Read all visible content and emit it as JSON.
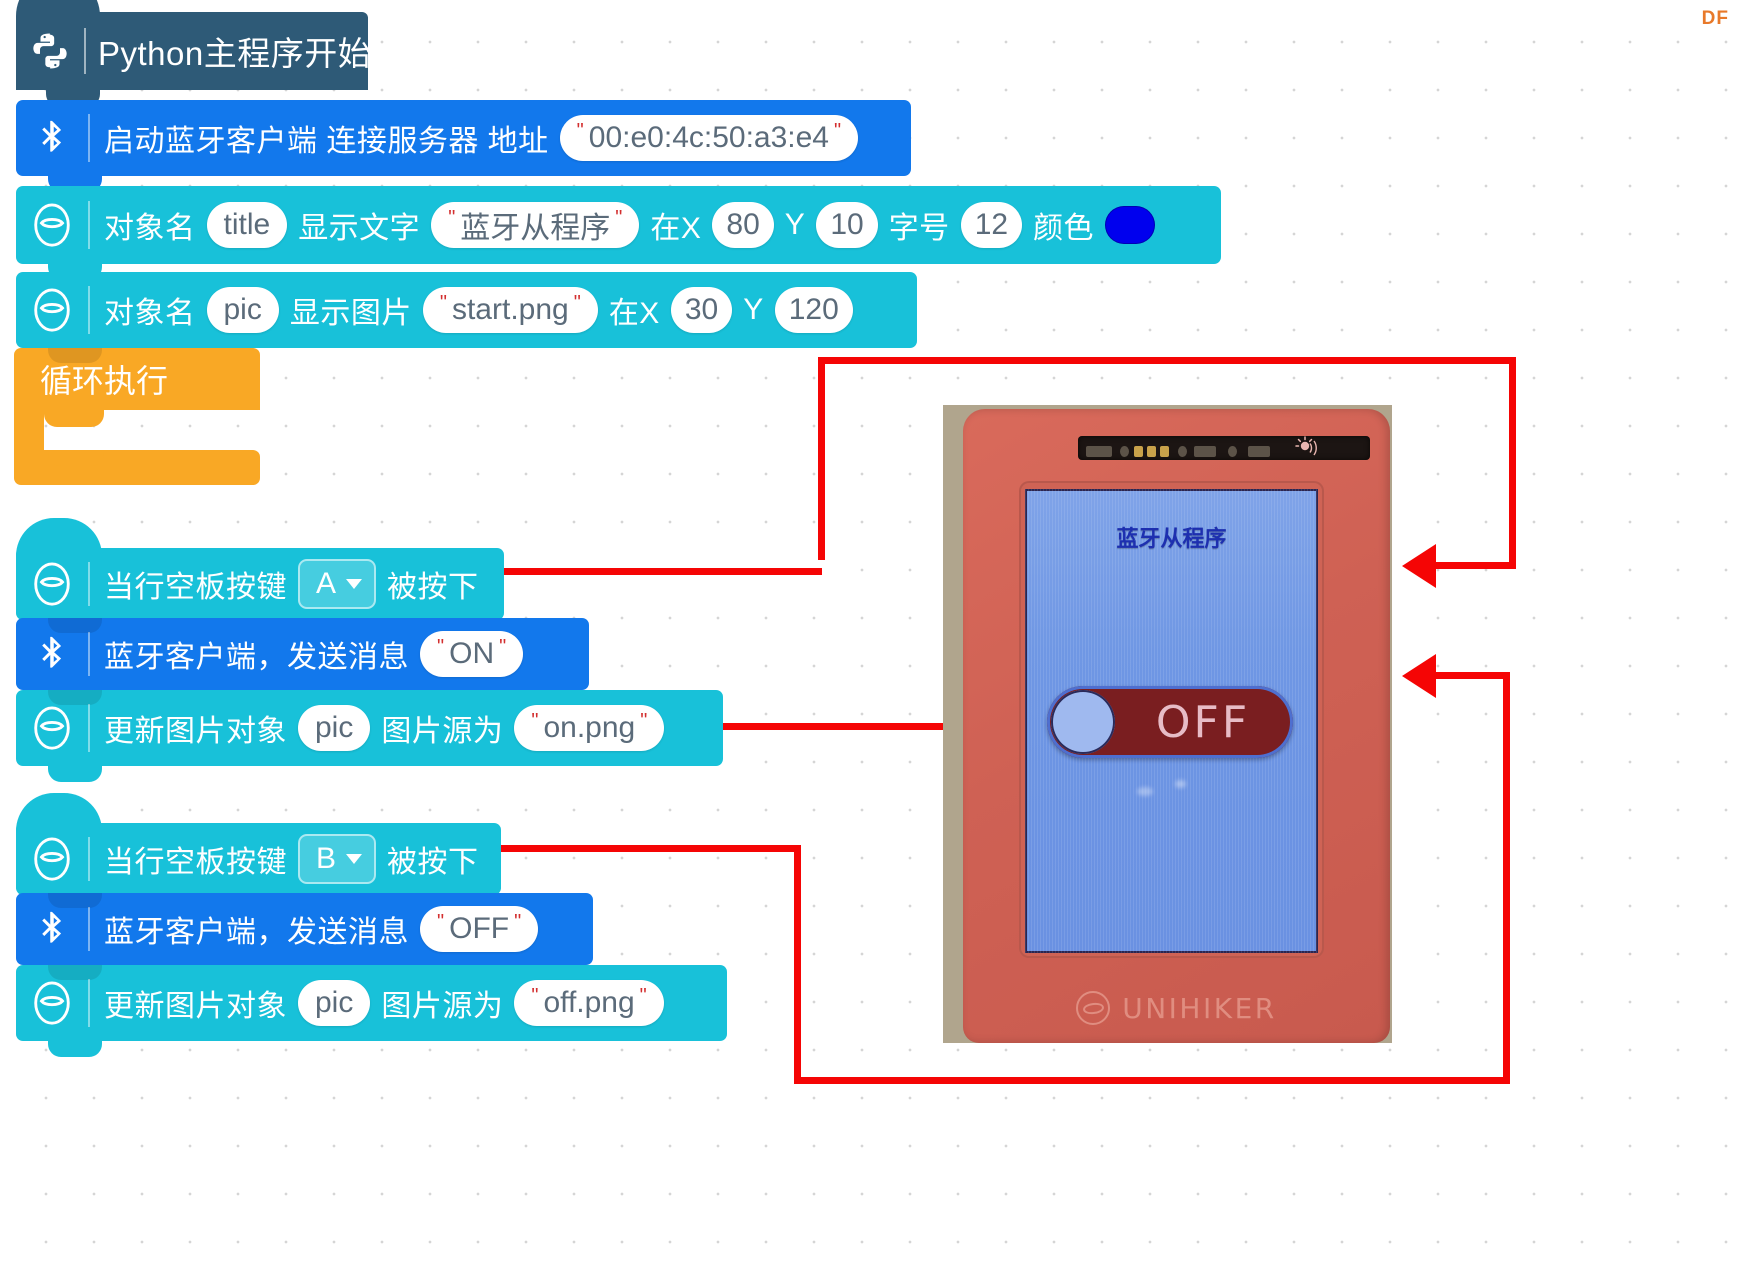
{
  "watermark": {
    "label": "DF"
  },
  "workspace": {
    "hat_block": {
      "icon": "python-icon",
      "label": "Python主程序开始"
    },
    "blocks": [
      {
        "id": "bluetooth-client-start",
        "icon": "bluetooth-icon",
        "label": "启动蓝牙客户端 连接服务器 地址",
        "value": "00:e0:4c:50:a3:e4"
      },
      {
        "id": "display-text",
        "icon": "unihiker-icon",
        "label_1": "对象名",
        "object_name": "title",
        "label_2": "显示文字",
        "text": "蓝牙从程序",
        "label_x": "在X",
        "x": "80",
        "label_y": "Y",
        "y": "10",
        "label_size": "字号",
        "size": "12",
        "label_color": "颜色",
        "color": "#0000ee"
      },
      {
        "id": "display-image",
        "icon": "unihiker-icon",
        "label_1": "对象名",
        "object_name": "pic",
        "label_2": "显示图片",
        "text": "start.png",
        "label_x": "在X",
        "x": "30",
        "label_y": "Y",
        "y": "120"
      }
    ],
    "loop_block": {
      "label": "循环执行"
    },
    "event_a": {
      "icon": "unihiker-icon",
      "label_prefix": "当行空板按键",
      "key": "A",
      "label_suffix": "被按下",
      "children": [
        {
          "id": "bt-send-on",
          "icon": "bluetooth-icon",
          "label": "蓝牙客户端，发送消息",
          "value": "ON"
        },
        {
          "id": "update-image-on",
          "icon": "unihiker-icon",
          "label_1": "更新图片对象",
          "object_name": "pic",
          "label_2": "图片源为",
          "value": "on.png"
        }
      ]
    },
    "event_b": {
      "icon": "unihiker-icon",
      "label_prefix": "当行空板按键",
      "key": "B",
      "label_suffix": "被按下",
      "children": [
        {
          "id": "bt-send-off",
          "icon": "bluetooth-icon",
          "label": "蓝牙客户端，发送消息",
          "value": "OFF"
        },
        {
          "id": "update-image-off",
          "icon": "unihiker-icon",
          "label_1": "更新图片对象",
          "object_name": "pic",
          "label_2": "图片源为",
          "value": "off.png"
        }
      ]
    }
  },
  "device_photo": {
    "brand": "UNIHIKER",
    "screen_title": "蓝牙从程序",
    "toggle_label": "OFF",
    "toggle_state": "off",
    "case_color": "#cf6154",
    "screen_color": "#6f97e4",
    "toggle_track_color": "#7a1e20"
  },
  "annotations": {
    "arrow_color": "#f50505",
    "arrows": [
      {
        "name": "arrow-title-to-screen",
        "from": "display-text block",
        "to": "screen title"
      },
      {
        "name": "arrow-event-a-to-screen",
        "from": "当行空板按键 A 被按下",
        "to": "device screen"
      },
      {
        "name": "arrow-on-png-to-toggle",
        "from": "on.png block",
        "to": "toggle knob"
      },
      {
        "name": "arrow-event-b-to-device",
        "from": "当行空板按键 B 被按下",
        "to": "device bottom"
      }
    ]
  }
}
